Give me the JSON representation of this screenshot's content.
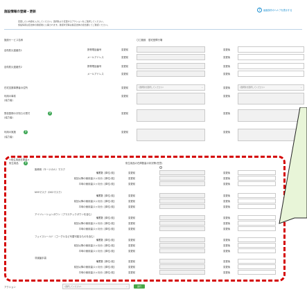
{
  "page": {
    "title": "施設情報の登録・更新",
    "help_link": "画面操作のヘルプを表示する",
    "intro_line1": "変更したい内容を入力してください。選択肢より変更するアクションをご選択してください。",
    "intro_line2": "施設情報は自治体の確認後に公開されます。確認状況等は各自治体の担当課にてご確認ください。"
  },
  "service": {
    "label": "施設サービス名称",
    "value": "〇〇施設　居宅型障行場"
  },
  "labels": {
    "before": "変更前",
    "after": "変更後",
    "phone": "携帯電話番号",
    "email": "メールアドレス",
    "select_placeholder": "(選択肢を選択してください)",
    "select_placeholder2": "(選択肢を選択してください)",
    "select_placeholder3": "(選択肢を選択してください)"
  },
  "rows": [
    {
      "label": "自衛防災連絡先1"
    },
    {
      "label": "自衛防災連絡先2"
    },
    {
      "label": "在宅支援事業者の住所"
    },
    {
      "label": "利用の事前",
      "sub": "(協力者)"
    },
    {
      "label": "受信登録のお知らせ受付",
      "sub": "(協力者)"
    },
    {
      "label": "利用の実施",
      "sub": "(協力者)"
    }
  ],
  "supplies": {
    "heading": "<衛生用品在庫量>",
    "heading2": "衛生用品",
    "column_note": "衛生用品の在庫数量の状況等(任意)",
    "fields": [
      "備蓄数【単位:枚】",
      "前回以降の使用量(1ヶ月分)【単位:枚】",
      "平時の使用量(1ヶ月分)【単位:枚】"
    ],
    "groups": [
      {
        "name": "医療用（サージカル）マスク"
      },
      {
        "name": "N95マスク（DS2マスク）"
      },
      {
        "name": "アイソレーションガウン（プラスチックガウンを含む）"
      },
      {
        "name": "フェイスシールド（ゴーグルなど代替可能なものを含む）"
      },
      {
        "name": "非滅菌手袋"
      }
    ]
  },
  "action": {
    "label": "アクション",
    "select_value": "(選択してください)",
    "go_label": "実行"
  },
  "colors": {
    "highlight_border": "#d40000",
    "callout_fill": "#e8f5d8",
    "question_badge": "#3aa552"
  }
}
